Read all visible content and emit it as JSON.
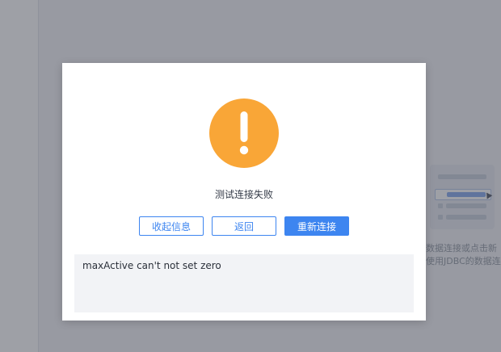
{
  "background": {
    "hint_lines": [
      "数据连接或点击新",
      "使用JDBC的数据连"
    ]
  },
  "dialog": {
    "icon": "exclamation-circle-icon",
    "title": "测试连接失败",
    "buttons": {
      "collapse_label": "收起信息",
      "back_label": "返回",
      "reconnect_label": "重新连接"
    },
    "error_detail": "maxActive can't not set zero"
  },
  "colors": {
    "accent": "#3d85f0",
    "warning": "#f9a637",
    "detail_bg": "#f2f3f6"
  }
}
